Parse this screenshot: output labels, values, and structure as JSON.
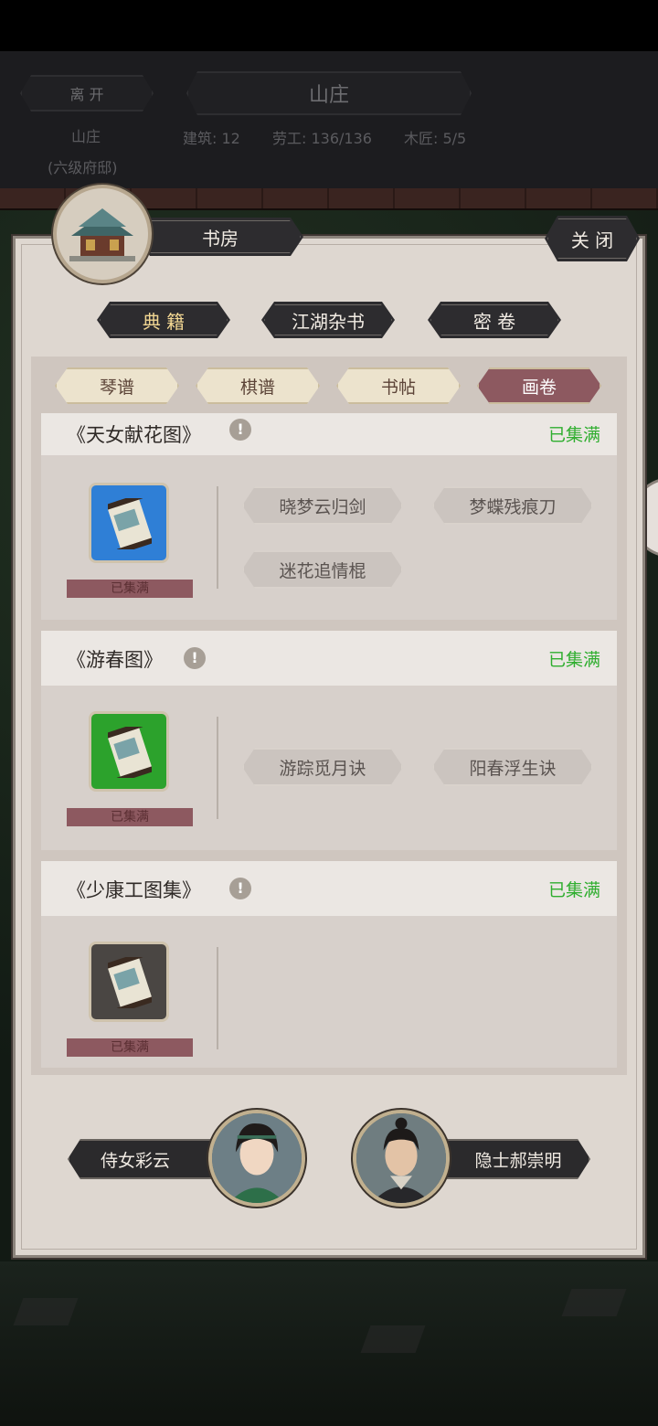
{
  "hud": {
    "leave_label": "离 开",
    "title": "山庄",
    "location": "山庄",
    "location_sub": "(六级府邸)",
    "stats": [
      "建筑: 12",
      "劳工: 136/136",
      "木匠: 5/5"
    ]
  },
  "panel": {
    "room_title": "书房",
    "close_label": "关 闭",
    "tabs": [
      "典 籍",
      "江湖杂书",
      "密 卷"
    ],
    "subtabs": [
      "琴谱",
      "棋谱",
      "书帖",
      "画卷"
    ],
    "active_subtab": "画卷"
  },
  "cards": [
    {
      "title": "《天女献花图》",
      "status": "已集满",
      "collected_label": "已集满",
      "frame_color": "#2f7fd6",
      "skills": [
        "晓梦云归剑",
        "梦蝶残痕刀",
        "迷花追情棍"
      ]
    },
    {
      "title": "《游春图》",
      "status": "已集满",
      "collected_label": "已集满",
      "frame_color": "#2ca22c",
      "skills": [
        "游踪觅月诀",
        "阳春浮生诀"
      ]
    },
    {
      "title": "《少康工图集》",
      "status": "已集满",
      "collected_label": "已集满",
      "frame_color": "#4a4643",
      "skills": []
    }
  ],
  "characters": [
    {
      "name": "侍女彩云"
    },
    {
      "name": "隐士郝崇明"
    }
  ],
  "colors": {
    "accent_maroon": "#8d5960",
    "status_green": "#2fae2f",
    "dark_button": "#2d2c2f"
  }
}
